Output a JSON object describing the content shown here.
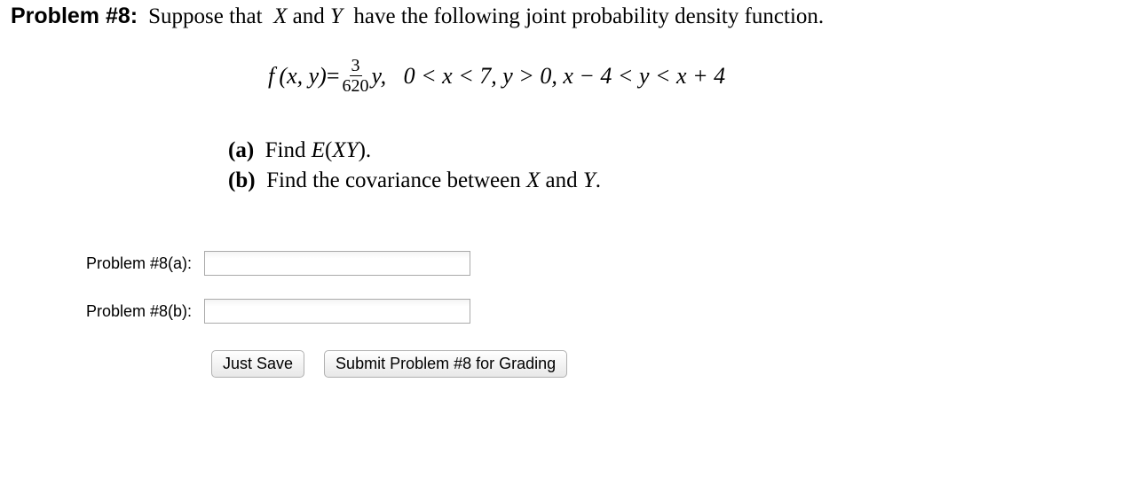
{
  "header": {
    "problem_number": "Problem #8:",
    "prompt": "Suppose that  X and Y  have the following joint probability density function."
  },
  "formula": {
    "lhs": "f (x, y)",
    "eq": " = ",
    "frac_num": "3",
    "frac_den": "620",
    "after_frac": "y,   0 < x < 7, y > 0, x − 4 < y < x + 4"
  },
  "questions": {
    "a_label": "(a)",
    "a_text": " Find E(XY).",
    "b_label": "(b)",
    "b_text": " Find the covariance between X and Y."
  },
  "answers": {
    "a_label": "Problem #8(a):",
    "b_label": "Problem #8(b):",
    "a_value": "",
    "b_value": ""
  },
  "buttons": {
    "save": "Just Save",
    "submit": "Submit Problem #8 for Grading"
  }
}
